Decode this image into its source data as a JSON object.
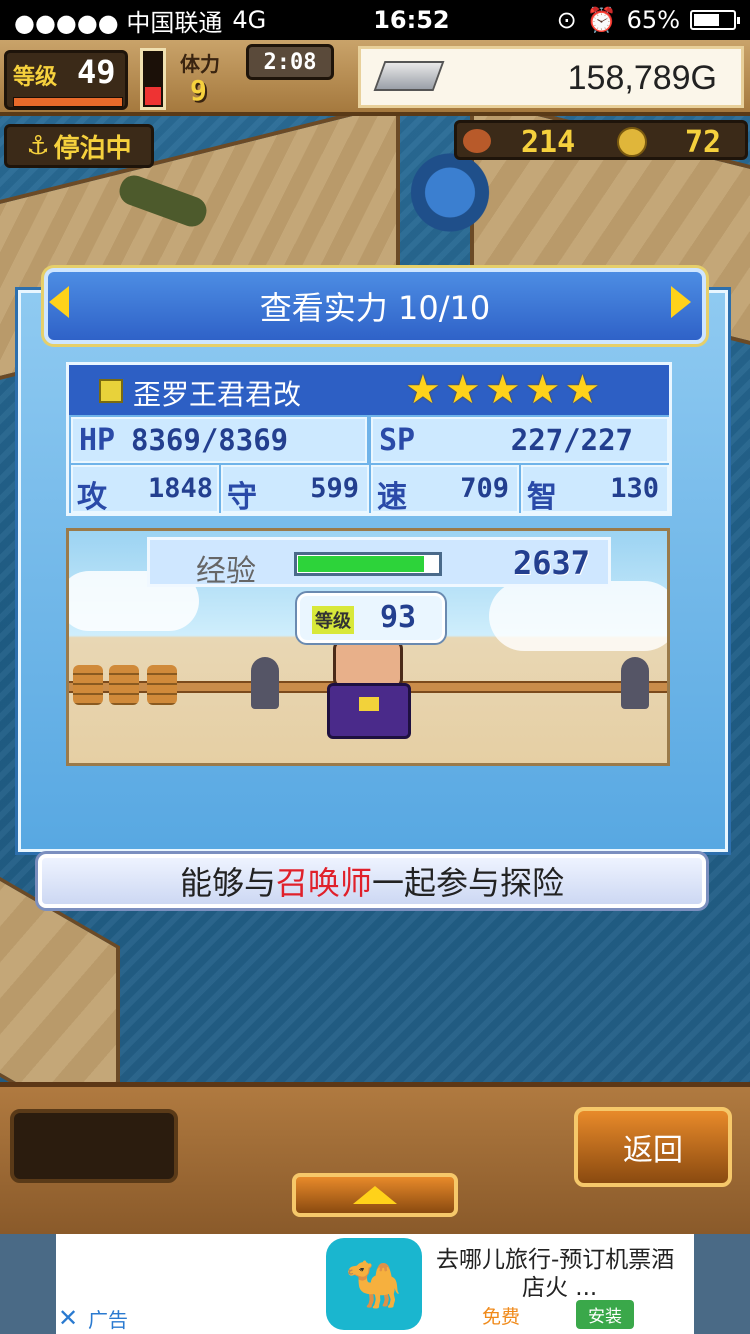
{
  "status_bar": {
    "carrier": "●●●●● 中国联通",
    "network": "4G",
    "time": "16:52",
    "battery": "65%"
  },
  "hud": {
    "level_label": "等级",
    "level_value": "49",
    "weather_label": "体力",
    "weather_value": "9",
    "timer": "2:08",
    "gold": "158,789G",
    "docked_label": "停泊中",
    "food": "214",
    "medals": "72"
  },
  "dialog": {
    "title": "查看实力 10/10",
    "character": {
      "name": "歪罗王君君改",
      "stars": 5,
      "hp_label": "HP",
      "hp_value": "8369/8369",
      "sp_label": "SP",
      "sp_value": "227/227",
      "atk_label": "攻",
      "atk_value": "1848",
      "def_label": "守",
      "def_value": "599",
      "spd_label": "速",
      "spd_value": "709",
      "int_label": "智",
      "int_value": "130"
    },
    "exp_label": "经验",
    "exp_fill": 0.9,
    "exp_value": "2637",
    "level_badge_label": "等级",
    "level_badge_value": "93",
    "message_parts": [
      "能够与",
      "召唤师",
      "一起参与探险"
    ]
  },
  "buttons": {
    "back": "返回"
  },
  "ad": {
    "title_line1": "去哪儿旅行-预订机票酒",
    "title_line2": "店火 ...",
    "free": "免费",
    "install": "安装",
    "label": "广告",
    "close": "✕"
  },
  "colors": {
    "highlight": "#e0202a",
    "star": "#ffd21a",
    "exp_bar": "#2dd33a",
    "title_blue": "#3a72d6"
  }
}
